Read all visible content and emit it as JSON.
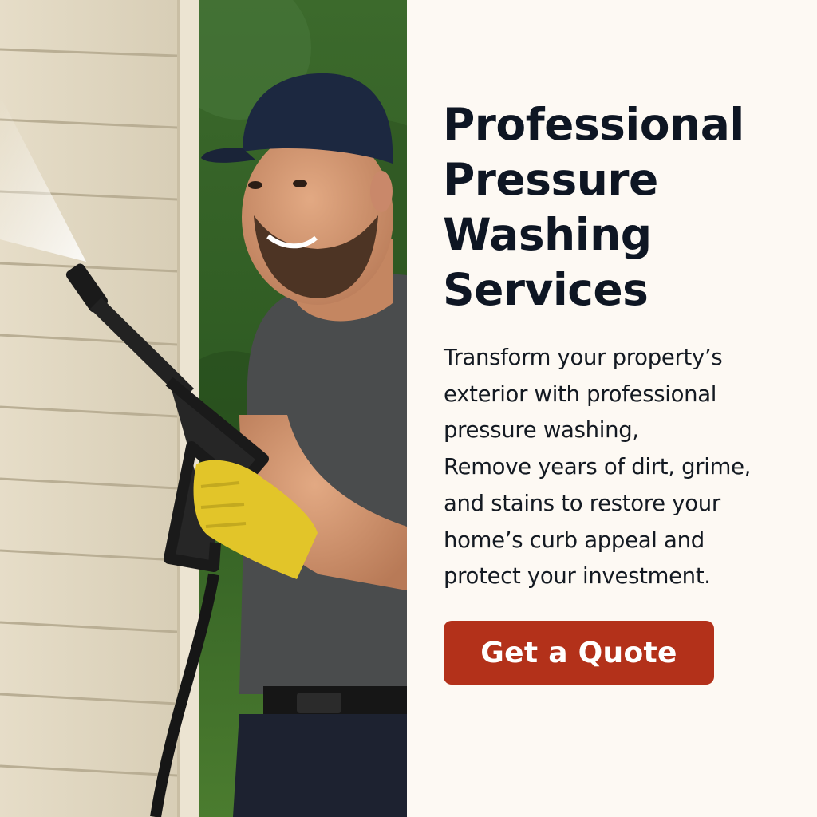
{
  "headline": {
    "lines": [
      "Professional",
      "Pressure",
      "Washing",
      "Services"
    ]
  },
  "description": {
    "lines": [
      "Transform your property’s",
      "exterior with professional",
      "pressure washing,",
      "Remove years of dirt, grime,",
      "and stains to restore your",
      "home’s curb appeal and",
      "protect your investment."
    ]
  },
  "cta": {
    "label": "Get a Quote"
  },
  "colors": {
    "background": "#fdf9f3",
    "headline": "#0e1623",
    "button": "#b3311a",
    "button_text": "#ffffff"
  }
}
